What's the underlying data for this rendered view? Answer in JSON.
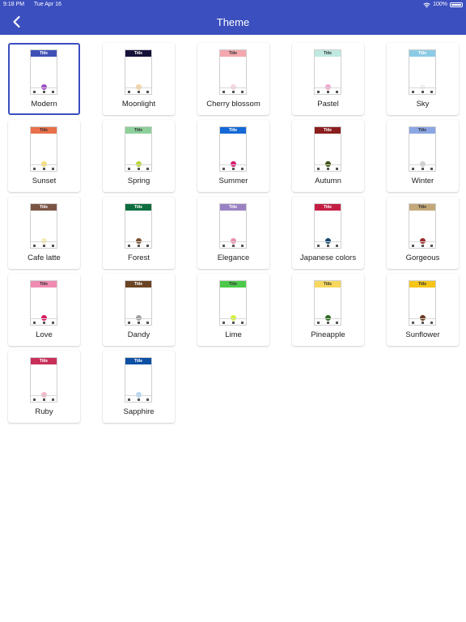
{
  "status_bar": {
    "time": "9:18 PM",
    "date": "Tue Apr 16",
    "battery": "100%",
    "icons": [
      "wifi-icon",
      "battery-icon"
    ]
  },
  "header": {
    "title": "Theme",
    "back_icon": "chevron-left-icon",
    "background": "#3b4fbf"
  },
  "selected_theme": "Modern",
  "themes": [
    {
      "label": "Modern",
      "preview_title": "Title",
      "title_bg": "#3f51b5",
      "title_fg": "#ffffff",
      "accent": "#9c4fc3"
    },
    {
      "label": "Moonlight",
      "preview_title": "Title",
      "title_bg": "#15123a",
      "title_fg": "#ffffff",
      "accent": "#f3d3a5"
    },
    {
      "label": "Cherry blossom",
      "preview_title": "Title",
      "title_bg": "#f4a7ae",
      "title_fg": "#333333",
      "accent": "#f7d6dd"
    },
    {
      "label": "Pastel",
      "preview_title": "Title",
      "title_bg": "#bfe9e1",
      "title_fg": "#333333",
      "accent": "#eeaacb"
    },
    {
      "label": "Sky",
      "preview_title": "Title",
      "title_bg": "#8ccbe6",
      "title_fg": "#ffffff",
      "accent": "#f1f1f1"
    },
    {
      "label": "Sunset",
      "preview_title": "Title",
      "title_bg": "#e8704a",
      "title_fg": "#333333",
      "accent": "#f7e07a"
    },
    {
      "label": "Spring",
      "preview_title": "Title",
      "title_bg": "#8ccf9a",
      "title_fg": "#333333",
      "accent": "#b7d63a"
    },
    {
      "label": "Summer",
      "preview_title": "Title",
      "title_bg": "#1569d6",
      "title_fg": "#ffffff",
      "accent": "#d81b71"
    },
    {
      "label": "Autumn",
      "preview_title": "Title",
      "title_bg": "#8b1e1e",
      "title_fg": "#ffffff",
      "accent": "#3f5614"
    },
    {
      "label": "Winter",
      "preview_title": "Title",
      "title_bg": "#8aa6e3",
      "title_fg": "#333333",
      "accent": "#cfcfcf"
    },
    {
      "label": "Cafe latte",
      "preview_title": "Title",
      "title_bg": "#7a5546",
      "title_fg": "#ffffff",
      "accent": "#f3ecba"
    },
    {
      "label": "Forest",
      "preview_title": "Title",
      "title_bg": "#0d6d3e",
      "title_fg": "#ffffff",
      "accent": "#7a5230"
    },
    {
      "label": "Elegance",
      "preview_title": "Title",
      "title_bg": "#9a82c2",
      "title_fg": "#ffffff",
      "accent": "#ea8fb3"
    },
    {
      "label": "Japanese colors",
      "preview_title": "Title",
      "title_bg": "#c41e44",
      "title_fg": "#ffffff",
      "accent": "#17476e"
    },
    {
      "label": "Gorgeous",
      "preview_title": "Title",
      "title_bg": "#c3a97a",
      "title_fg": "#333333",
      "accent": "#9c2a2a"
    },
    {
      "label": "Love",
      "preview_title": "Title",
      "title_bg": "#ef8ab0",
      "title_fg": "#333333",
      "accent": "#d81b60"
    },
    {
      "label": "Dandy",
      "preview_title": "Title",
      "title_bg": "#6b4423",
      "title_fg": "#ffffff",
      "accent": "#a3a3a3"
    },
    {
      "label": "Lime",
      "preview_title": "Title",
      "title_bg": "#4cc94a",
      "title_fg": "#333333",
      "accent": "#d6ef3a"
    },
    {
      "label": "Pineapple",
      "preview_title": "Title",
      "title_bg": "#f7d85e",
      "title_fg": "#333333",
      "accent": "#2b6e1f"
    },
    {
      "label": "Sunflower",
      "preview_title": "Title",
      "title_bg": "#f5c518",
      "title_fg": "#333333",
      "accent": "#6b3b1f"
    },
    {
      "label": "Ruby",
      "preview_title": "Title",
      "title_bg": "#c8305a",
      "title_fg": "#ffffff",
      "accent": "#f4b8c8"
    },
    {
      "label": "Sapphire",
      "preview_title": "Title",
      "title_bg": "#0d4fa3",
      "title_fg": "#ffffff",
      "accent": "#b8d7f4"
    }
  ]
}
